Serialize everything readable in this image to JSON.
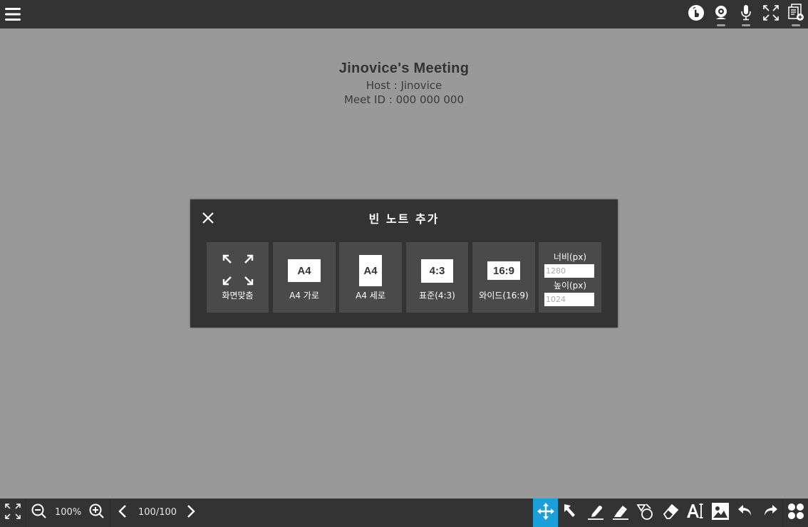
{
  "meeting": {
    "title": "Jinovice's Meeting",
    "host": "Host : Jinovice",
    "meet_id": "Meet ID : 000 000 000"
  },
  "modal": {
    "title": "빈 노트 추가",
    "options": [
      {
        "label": "화면맞춤",
        "icon": "fit-screen-icon"
      },
      {
        "label": "A4 가로",
        "icon_text": "A4"
      },
      {
        "label": "A4 세로",
        "icon_text": "A4"
      },
      {
        "label": "표준(4:3)",
        "icon_text": "4:3"
      },
      {
        "label": "와이드(16:9)",
        "icon_text": "16:9"
      }
    ],
    "custom": {
      "width_label": "너비(px)",
      "width_value": "1280",
      "height_label": "높이(px)",
      "height_value": "1024"
    }
  },
  "bottombar": {
    "zoom": "100%",
    "page": "100/100"
  },
  "colors": {
    "bar": "#333333",
    "canvas": "#999999",
    "active_tool": "#1a9fd8"
  }
}
